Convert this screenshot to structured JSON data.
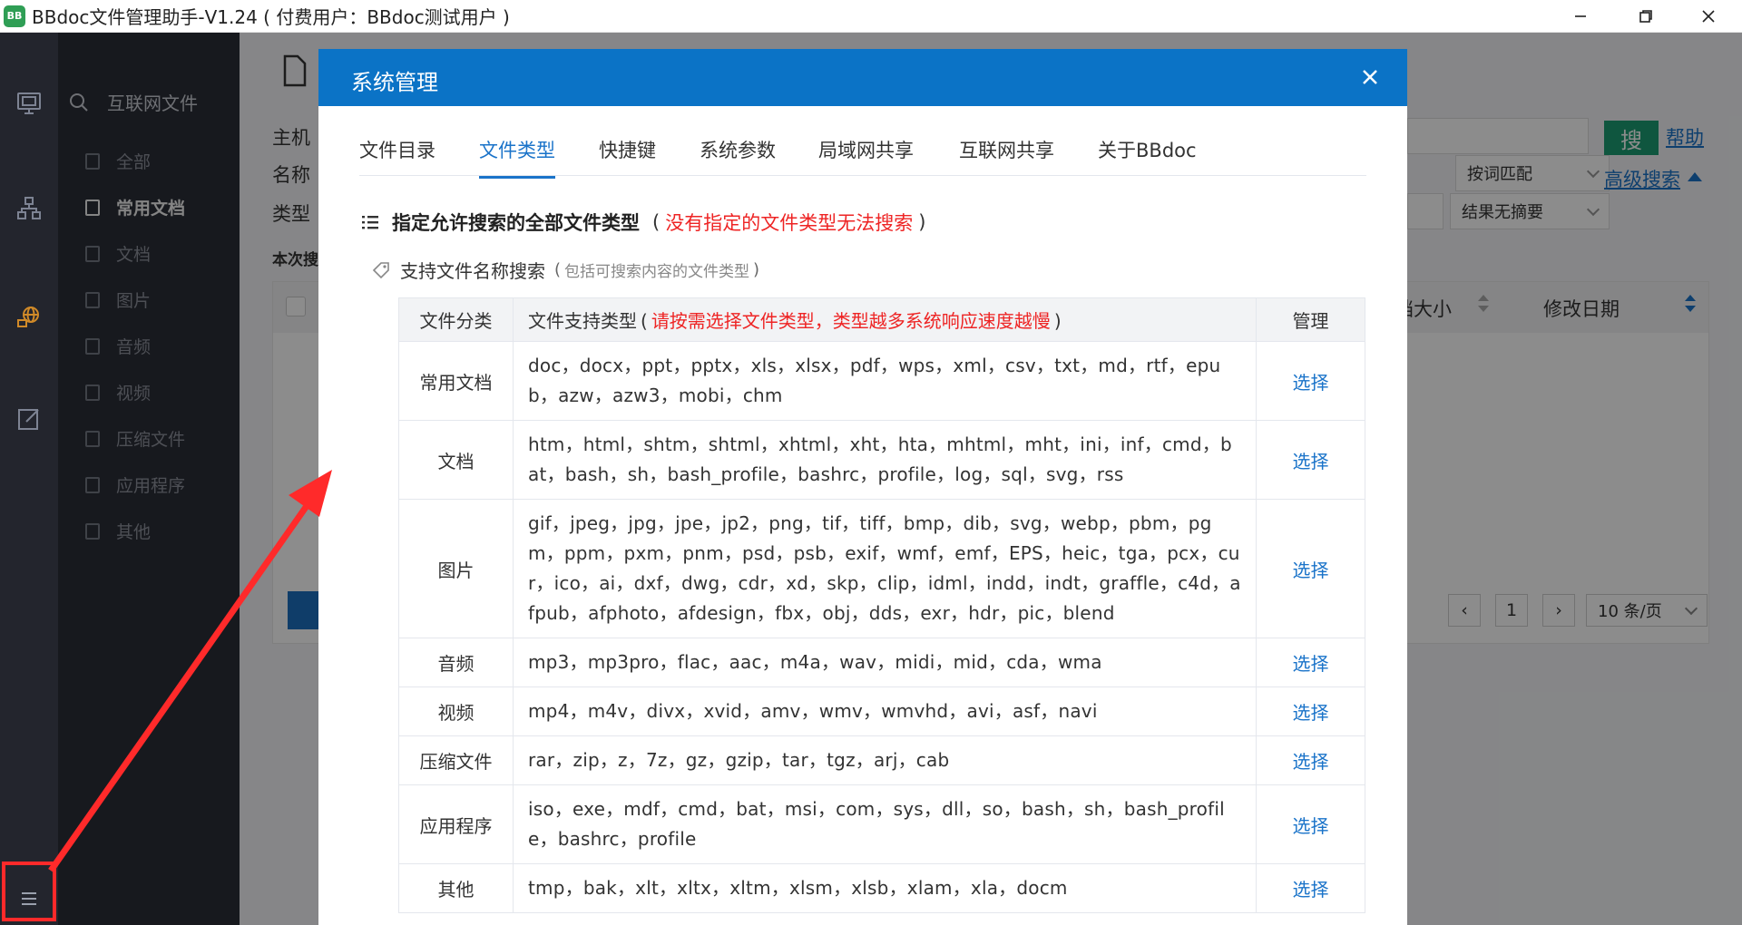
{
  "window": {
    "logo": "BB",
    "title": "BBdoc文件管理助手-V1.24 ( 付费用户：BBdoc测试用户 )"
  },
  "sidebar": {
    "header": "互联网文件",
    "items": [
      {
        "label": "全部"
      },
      {
        "label": "常用文档"
      },
      {
        "label": "文档"
      },
      {
        "label": "图片"
      },
      {
        "label": "音频"
      },
      {
        "label": "视频"
      },
      {
        "label": "压缩文件"
      },
      {
        "label": "应用程序"
      },
      {
        "label": "其他"
      }
    ]
  },
  "main": {
    "host_label": "主机",
    "name_label": "名称",
    "type_label": "类型",
    "this_search_label": "本次搜",
    "match_select": "按词匹配",
    "summary_select": "结果无摘要",
    "search_button": "搜",
    "help_link": "帮助",
    "advanced_search": "高级搜索",
    "col_size": "档大小",
    "col_modified": "修改日期",
    "page_current": "1",
    "page_size": "10 条/页"
  },
  "dialog": {
    "title": "系统管理",
    "tabs": [
      {
        "label": "文件目录"
      },
      {
        "label": "文件类型"
      },
      {
        "label": "快捷键"
      },
      {
        "label": "系统参数"
      },
      {
        "label": "局域网共享"
      },
      {
        "label": "互联网共享"
      },
      {
        "label": "关于BBdoc"
      }
    ],
    "section_title": "指定允许搜索的全部文件类型",
    "section_open": "(",
    "section_warning": "没有指定的文件类型无法搜索",
    "section_close": ")",
    "subsection_title": "支持文件名称搜索",
    "subsection_open": "(",
    "subsection_note": "包括可搜索内容的文件类型",
    "subsection_close": ")",
    "table": {
      "col_category": "文件分类",
      "col_types": "文件支持类型",
      "col_types_open": "(",
      "col_types_note": "请按需选择文件类型，类型越多系统响应速度越慢",
      "col_types_close": ")",
      "col_manage": "管理",
      "rows": [
        {
          "category": "常用文档",
          "types": "doc，docx，ppt，pptx，xls，xlsx，pdf，wps，xml，csv，txt，md，rtf，epub，azw，azw3，mobi，chm",
          "action": "选择"
        },
        {
          "category": "文档",
          "types": "htm，html，shtm，shtml，xhtml，xht，hta，mhtml，mht，ini，inf，cmd，bat，bash，sh，bash_profile，bashrc，profile，log，sql，svg，rss",
          "action": "选择"
        },
        {
          "category": "图片",
          "types": "gif，jpeg，jpg，jpe，jp2，png，tif，tiff，bmp，dib，svg，webp，pbm，pgm，ppm，pxm，pnm，psd，psb，exif，wmf，emf，EPS，heic，tga，pcx，cur，ico，ai，dxf，dwg，cdr，xd，skp，clip，idml，indd，indt，graffle，c4d，afpub，afphoto，afdesign，fbx，obj，dds，exr，hdr，pic，blend",
          "action": "选择"
        },
        {
          "category": "音频",
          "types": "mp3，mp3pro，flac，aac，m4a，wav，midi，mid，cda，wma",
          "action": "选择"
        },
        {
          "category": "视频",
          "types": "mp4，m4v，divx，xvid，amv，wmv，wmvhd，avi，asf，navi",
          "action": "选择"
        },
        {
          "category": "压缩文件",
          "types": "rar，zip，z，7z，gz，gzip，tar，tgz，arj，cab",
          "action": "选择"
        },
        {
          "category": "应用程序",
          "types": "iso，exe，mdf，cmd，bat，msi，com，sys，dll，so，bash，sh，bash_profile，bashrc，profile",
          "action": "选择"
        },
        {
          "category": "其他",
          "types": "tmp，bak，xlt，xltx，xltm，xlsm，xlsb，xlam，xla，docm",
          "action": "选择"
        }
      ]
    }
  },
  "colors": {
    "dialog_header": "#0b73c6",
    "accent_link": "#1a73c9",
    "warning_red": "#ee2424",
    "annotation_red": "#ff2a2a",
    "rail_bg": "#23252d",
    "sidebar_bg": "#2b2e37",
    "search_button": "#1d9d74"
  }
}
